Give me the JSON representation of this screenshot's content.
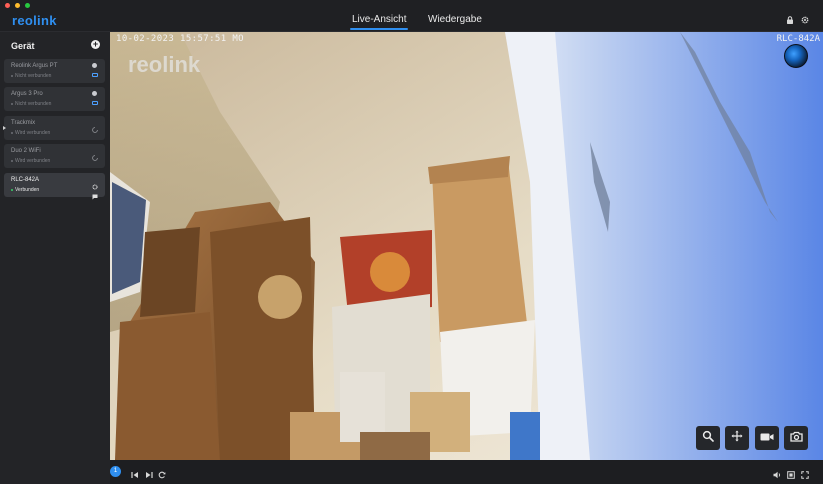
{
  "app": {
    "logo_text": "reolink"
  },
  "tabs": [
    {
      "label": "Live-Ansicht",
      "active": true
    },
    {
      "label": "Wiedergabe",
      "active": false
    }
  ],
  "sidebar": {
    "title": "Gerät",
    "devices": [
      {
        "name": "Reolink Argus PT",
        "status": "Nicht verbunden",
        "active": false
      },
      {
        "name": "Argus 3 Pro",
        "status": "Nicht verbunden",
        "active": false
      },
      {
        "name": "Trackmix",
        "status": "Wird verbunden",
        "active": false
      },
      {
        "name": "Duo 2 WiFi",
        "status": "Wird verbunden",
        "active": false
      },
      {
        "name": "RLC-842A",
        "status": "Verbunden",
        "active": true
      }
    ]
  },
  "video": {
    "watermark": "reolink",
    "timestamp": "10-02-2023 15:57:51 MO",
    "camera_name": "RLC-842A"
  },
  "bottombar": {
    "stream_count": "1"
  },
  "colors": {
    "accent": "#2f8ff0",
    "background": "#1b1c1e",
    "sidebar": "#232427"
  }
}
